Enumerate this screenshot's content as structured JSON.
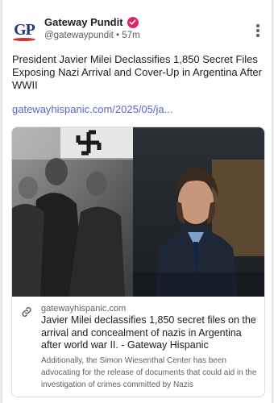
{
  "post": {
    "author": {
      "avatar_initials": "GP",
      "display_name": "Gateway Pundit",
      "verified_icon": "verified-badge-icon",
      "handle": "@gatewaypundit",
      "separator": "•",
      "time_ago": "57m"
    },
    "menu_icon": "more-options-icon",
    "text": "President Javier Milei Declassifies 1,850 Secret Files Exposing Nazi Arrival and Cover-Up in Argentina After WWII",
    "link_text": "gatewayhispanic.com/2025/05/ja...",
    "link_card": {
      "image_description": "photo collage",
      "link_icon": "link-icon",
      "domain": "gatewayhispanic.com",
      "title": "Javier Milei declassifies 1,850 secret files on the arrival and concealment of nazis in Argentina after world war II. - Gateway Hispanic",
      "description": "Additionally, the Simon Wiesenthal Center has been advocating for the release of documents that could aid in the investigation of crimes committed by Nazis"
    }
  },
  "colors": {
    "accent_link": "#5b66c9",
    "verified": "#e0245e",
    "text_primary": "#1d1d22",
    "text_secondary": "#5f6068"
  }
}
